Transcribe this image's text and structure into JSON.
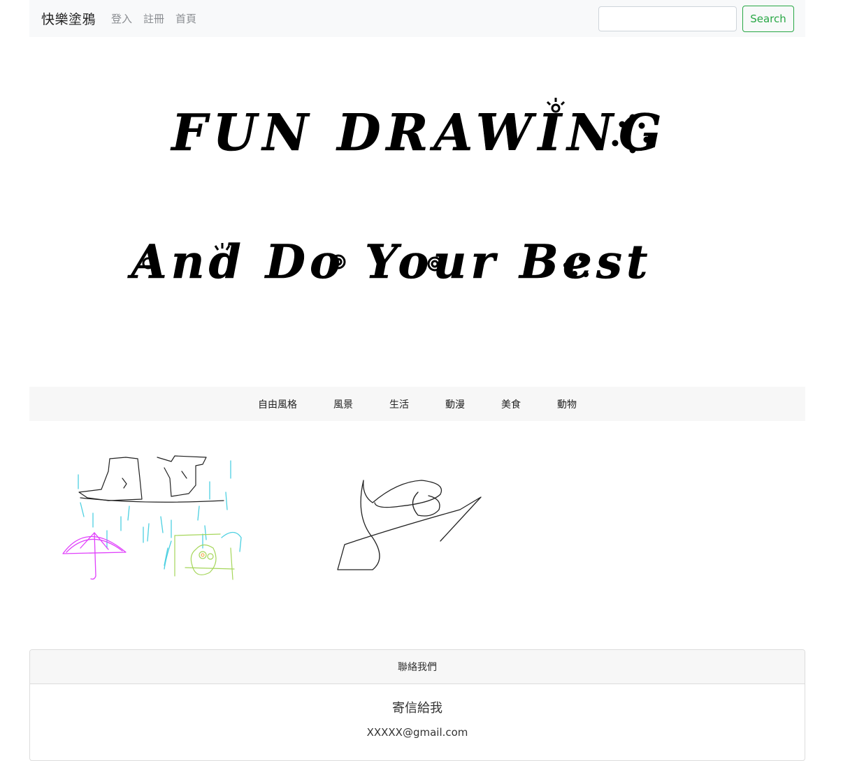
{
  "navbar": {
    "brand": "快樂塗鴉",
    "links": [
      "登入",
      "註冊",
      "首頁"
    ],
    "search_placeholder": "",
    "search_label": "Search"
  },
  "banner": {
    "line1": "FUN DRAWING",
    "line2": "And Do Your Best"
  },
  "categories": [
    "自由風格",
    "風景",
    "生活",
    "動漫",
    "美食",
    "動物"
  ],
  "contact": {
    "header": "聯絡我們",
    "title": "寄信給我",
    "email": "XXXXX@gmail.com"
  },
  "colors": {
    "nav_bg": "#f8f9fa",
    "search_green": "#28a745",
    "rain": "#4dd0e1",
    "umbrella": "#e040fb",
    "plant": "#a5d65a",
    "ink": "#222222"
  }
}
